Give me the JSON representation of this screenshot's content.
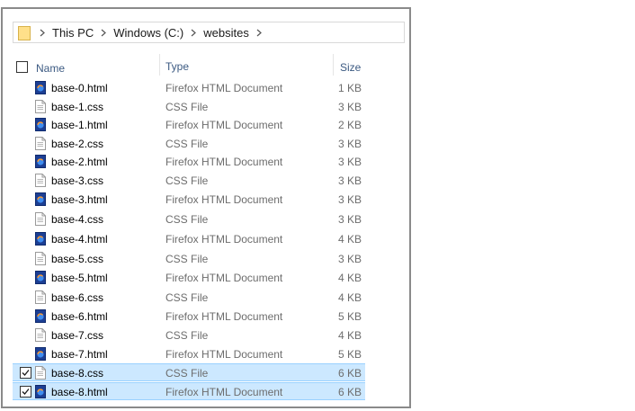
{
  "breadcrumb": {
    "items": [
      "This PC",
      "Windows (C:)",
      "websites"
    ]
  },
  "header": {
    "name": "Name",
    "type": "Type",
    "size": "Size"
  },
  "colors": {
    "selection_bg": "#cce8ff",
    "selection_border": "#99d1ff",
    "header_text": "#3c5a82",
    "secondary_text": "#6d6d6d",
    "firefox_icon": "#1c3f94"
  },
  "files": [
    {
      "name": "base-0.html",
      "type": "Firefox HTML Document",
      "size": "1 KB",
      "icon": "firefox-html-icon",
      "selected": false
    },
    {
      "name": "base-1.css",
      "type": "CSS File",
      "size": "3 KB",
      "icon": "css-file-icon",
      "selected": false
    },
    {
      "name": "base-1.html",
      "type": "Firefox HTML Document",
      "size": "2 KB",
      "icon": "firefox-html-icon",
      "selected": false
    },
    {
      "name": "base-2.css",
      "type": "CSS File",
      "size": "3 KB",
      "icon": "css-file-icon",
      "selected": false
    },
    {
      "name": "base-2.html",
      "type": "Firefox HTML Document",
      "size": "3 KB",
      "icon": "firefox-html-icon",
      "selected": false
    },
    {
      "name": "base-3.css",
      "type": "CSS File",
      "size": "3 KB",
      "icon": "css-file-icon",
      "selected": false
    },
    {
      "name": "base-3.html",
      "type": "Firefox HTML Document",
      "size": "3 KB",
      "icon": "firefox-html-icon",
      "selected": false
    },
    {
      "name": "base-4.css",
      "type": "CSS File",
      "size": "3 KB",
      "icon": "css-file-icon",
      "selected": false
    },
    {
      "name": "base-4.html",
      "type": "Firefox HTML Document",
      "size": "4 KB",
      "icon": "firefox-html-icon",
      "selected": false
    },
    {
      "name": "base-5.css",
      "type": "CSS File",
      "size": "3 KB",
      "icon": "css-file-icon",
      "selected": false
    },
    {
      "name": "base-5.html",
      "type": "Firefox HTML Document",
      "size": "4 KB",
      "icon": "firefox-html-icon",
      "selected": false
    },
    {
      "name": "base-6.css",
      "type": "CSS File",
      "size": "4 KB",
      "icon": "css-file-icon",
      "selected": false
    },
    {
      "name": "base-6.html",
      "type": "Firefox HTML Document",
      "size": "5 KB",
      "icon": "firefox-html-icon",
      "selected": false
    },
    {
      "name": "base-7.css",
      "type": "CSS File",
      "size": "4 KB",
      "icon": "css-file-icon",
      "selected": false
    },
    {
      "name": "base-7.html",
      "type": "Firefox HTML Document",
      "size": "5 KB",
      "icon": "firefox-html-icon",
      "selected": false
    },
    {
      "name": "base-8.css",
      "type": "CSS File",
      "size": "6 KB",
      "icon": "css-file-icon",
      "selected": true
    },
    {
      "name": "base-8.html",
      "type": "Firefox HTML Document",
      "size": "6 KB",
      "icon": "firefox-html-icon",
      "selected": true
    }
  ]
}
